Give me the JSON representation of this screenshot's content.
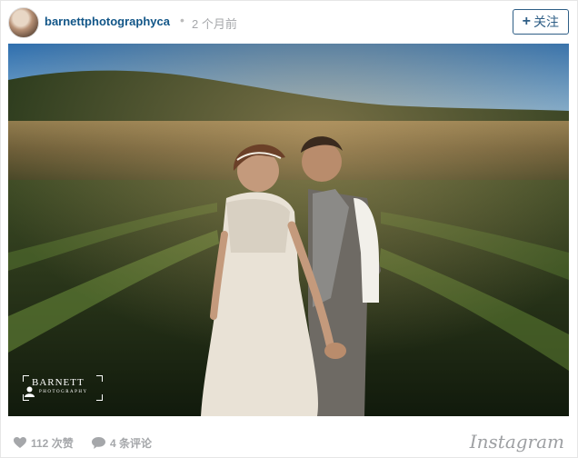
{
  "header": {
    "username": "barnettphotographyca",
    "separator": "•",
    "time_ago": "2 个月前",
    "follow_label": "关注",
    "follow_plus": "+"
  },
  "photo": {
    "watermark_title": "BARNETT",
    "watermark_subtitle": "PHOTOGRAPHY"
  },
  "footer": {
    "likes": "112 次赞",
    "comments": "4 条评论",
    "brand": "Instagram"
  },
  "colors": {
    "username": "#125688",
    "follow_border": "#2e5e86",
    "muted_text": "#a5a7aa"
  },
  "icons": {
    "likes": "heart-icon",
    "comments": "speech-bubble-icon",
    "watermark": "person-icon"
  }
}
